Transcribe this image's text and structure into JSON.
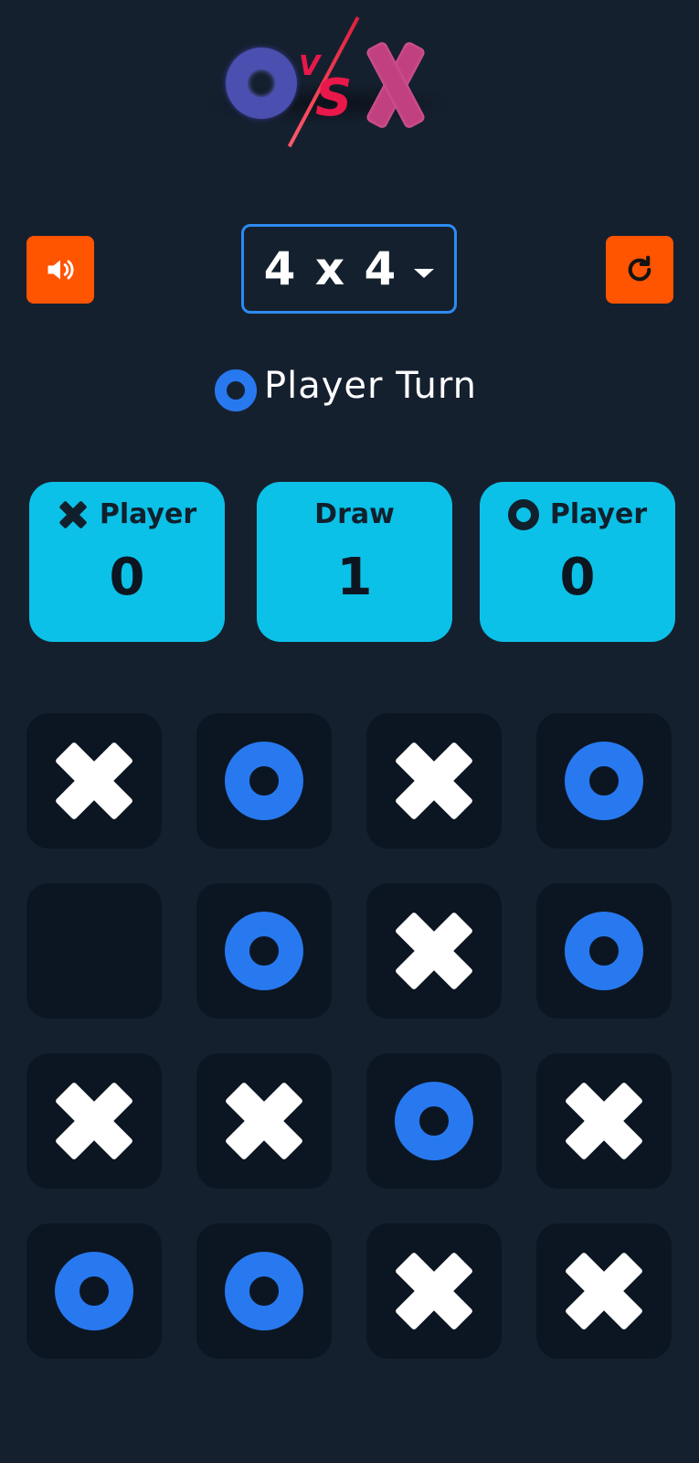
{
  "logo": {
    "o_letter": "O",
    "vs_text": "VS",
    "x_letter": "X"
  },
  "controls": {
    "sound_icon": "speaker-icon",
    "restart_icon": "restart-icon",
    "grid_size": "4 x 4"
  },
  "turn": {
    "current_mark": "O",
    "label": "Player Turn"
  },
  "scores": {
    "x_player": {
      "label": "Player",
      "value": "0",
      "mark": "X"
    },
    "draw": {
      "label": "Draw",
      "value": "1"
    },
    "o_player": {
      "label": "Player",
      "value": "0",
      "mark": "O"
    }
  },
  "board": {
    "size": 4,
    "cells": [
      [
        "X",
        "O",
        "X",
        "O"
      ],
      [
        "",
        "O",
        "X",
        "O"
      ],
      [
        "X",
        "X",
        "O",
        "X"
      ],
      [
        "O",
        "O",
        "X",
        "X"
      ]
    ]
  },
  "colors": {
    "background": "#15202f",
    "accent_button": "#ff5400",
    "score_card": "#0cc1e8",
    "o_mark": "#2879f0",
    "x_mark": "#ffffff",
    "cell": "#0c1622",
    "select_border": "#2d8bf0"
  }
}
